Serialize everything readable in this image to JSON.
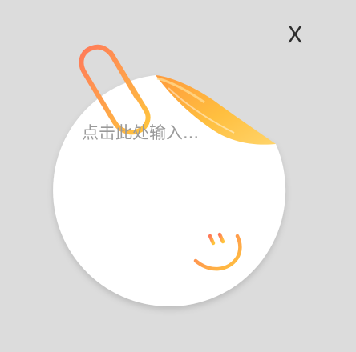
{
  "dialog": {
    "close_label": "X",
    "note_input": {
      "value": "",
      "placeholder": "点击此处输入..."
    }
  },
  "icons": {
    "close": "close-icon",
    "clip": "paperclip-icon",
    "curl": "page-curl-icon",
    "face": "smiley-face-icon"
  },
  "colors": {
    "background": "#dcdcdc",
    "note": "#ffffff",
    "accent_start": "#ff7a59",
    "accent_end": "#ffc53d",
    "close_text": "#2f2f2f"
  }
}
